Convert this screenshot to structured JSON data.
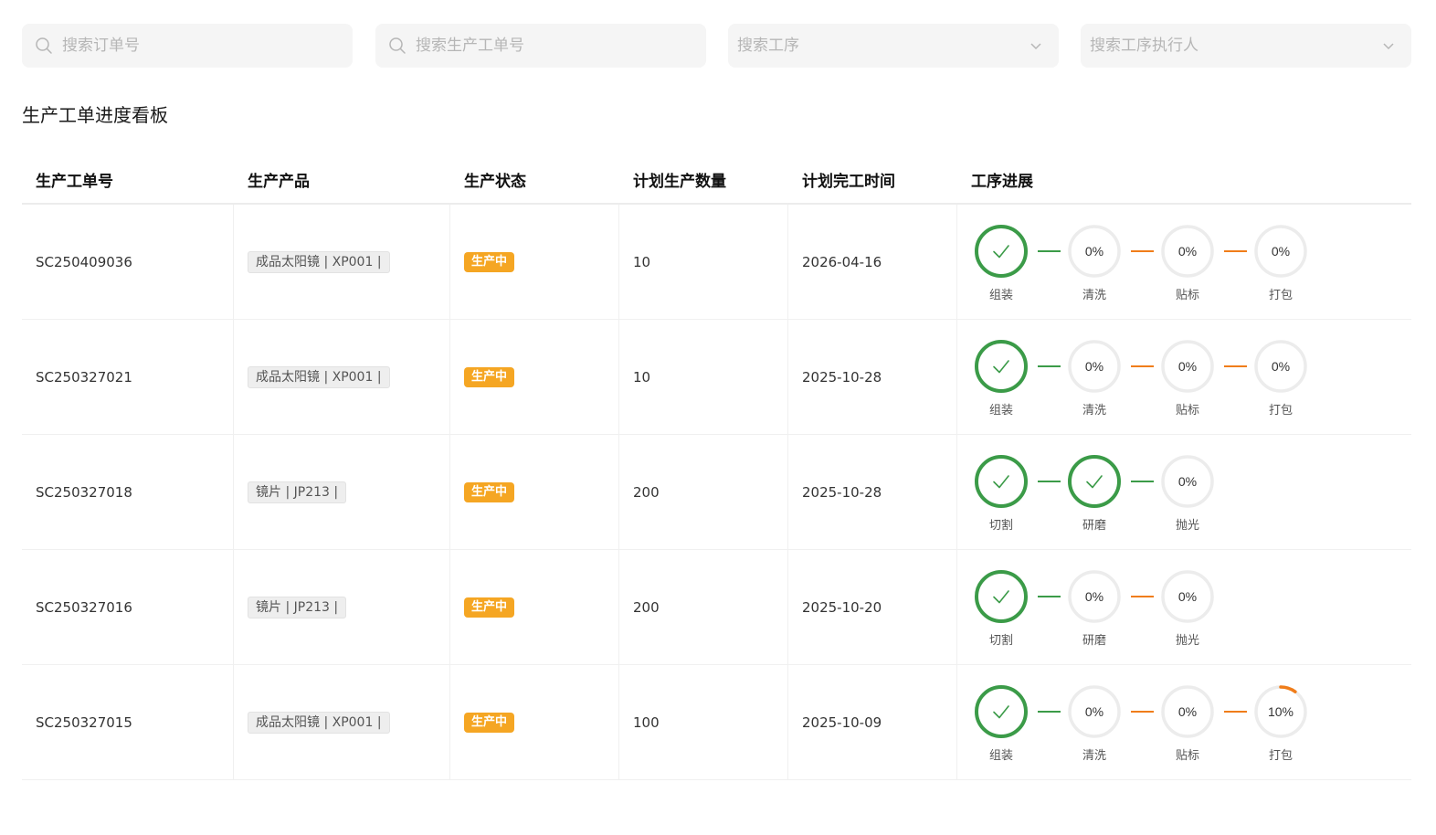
{
  "filters": {
    "order_search": "搜索订单号",
    "production_search": "搜索生产工单号",
    "process_select": "搜索工序",
    "executor_select": "搜索工序执行人"
  },
  "page_title": "生产工单进度看板",
  "table": {
    "headers": [
      "生产工单号",
      "生产产品",
      "生产状态",
      "计划生产数量",
      "计划完工时间",
      "工序进展"
    ],
    "rows": [
      {
        "order_no": "SC250409036",
        "product": "成品太阳镜 | XP001 |",
        "status": "生产中",
        "qty": "10",
        "date": "2026-04-16",
        "steps": [
          {
            "name": "组装",
            "done": true,
            "progress": 1.0,
            "text": ""
          },
          {
            "name": "清洗",
            "done": false,
            "progress": 0.0,
            "text": "0%"
          },
          {
            "name": "贴标",
            "done": false,
            "progress": 0.0,
            "text": "0%"
          },
          {
            "name": "打包",
            "done": false,
            "progress": 0.0,
            "text": "0%"
          }
        ]
      },
      {
        "order_no": "SC250327021",
        "product": "成品太阳镜 | XP001 |",
        "status": "生产中",
        "qty": "10",
        "date": "2025-10-28",
        "steps": [
          {
            "name": "组装",
            "done": true,
            "progress": 1.0,
            "text": ""
          },
          {
            "name": "清洗",
            "done": false,
            "progress": 0.0,
            "text": "0%"
          },
          {
            "name": "贴标",
            "done": false,
            "progress": 0.0,
            "text": "0%"
          },
          {
            "name": "打包",
            "done": false,
            "progress": 0.0,
            "text": "0%"
          }
        ]
      },
      {
        "order_no": "SC250327018",
        "product": "镜片 | JP213 |",
        "status": "生产中",
        "qty": "200",
        "date": "2025-10-28",
        "steps": [
          {
            "name": "切割",
            "done": true,
            "progress": 1.0,
            "text": ""
          },
          {
            "name": "研磨",
            "done": true,
            "progress": 1.0,
            "text": ""
          },
          {
            "name": "抛光",
            "done": false,
            "progress": 0.0,
            "text": "0%"
          }
        ]
      },
      {
        "order_no": "SC250327016",
        "product": "镜片 | JP213 |",
        "status": "生产中",
        "qty": "200",
        "date": "2025-10-20",
        "steps": [
          {
            "name": "切割",
            "done": true,
            "progress": 1.0,
            "text": ""
          },
          {
            "name": "研磨",
            "done": false,
            "progress": 0.0,
            "text": "0%"
          },
          {
            "name": "抛光",
            "done": false,
            "progress": 0.0,
            "text": "0%"
          }
        ]
      },
      {
        "order_no": "SC250327015",
        "product": "成品太阳镜 | XP001 |",
        "status": "生产中",
        "qty": "100",
        "date": "2025-10-09",
        "steps": [
          {
            "name": "组装",
            "done": true,
            "progress": 1.0,
            "text": ""
          },
          {
            "name": "清洗",
            "done": false,
            "progress": 0.0,
            "text": "0%"
          },
          {
            "name": "贴标",
            "done": false,
            "progress": 0.0,
            "text": "0%"
          },
          {
            "name": "打包",
            "done": false,
            "progress": 0.1,
            "text": "10%"
          }
        ]
      }
    ]
  },
  "colors": {
    "done": "#3b9b48",
    "in_progress": "#f07d1a",
    "ring_track": "#ececec",
    "status": "#f5a623"
  },
  "icons": {
    "search": "search-icon",
    "dropdown": "chevron-down-icon",
    "done": "check-icon"
  }
}
